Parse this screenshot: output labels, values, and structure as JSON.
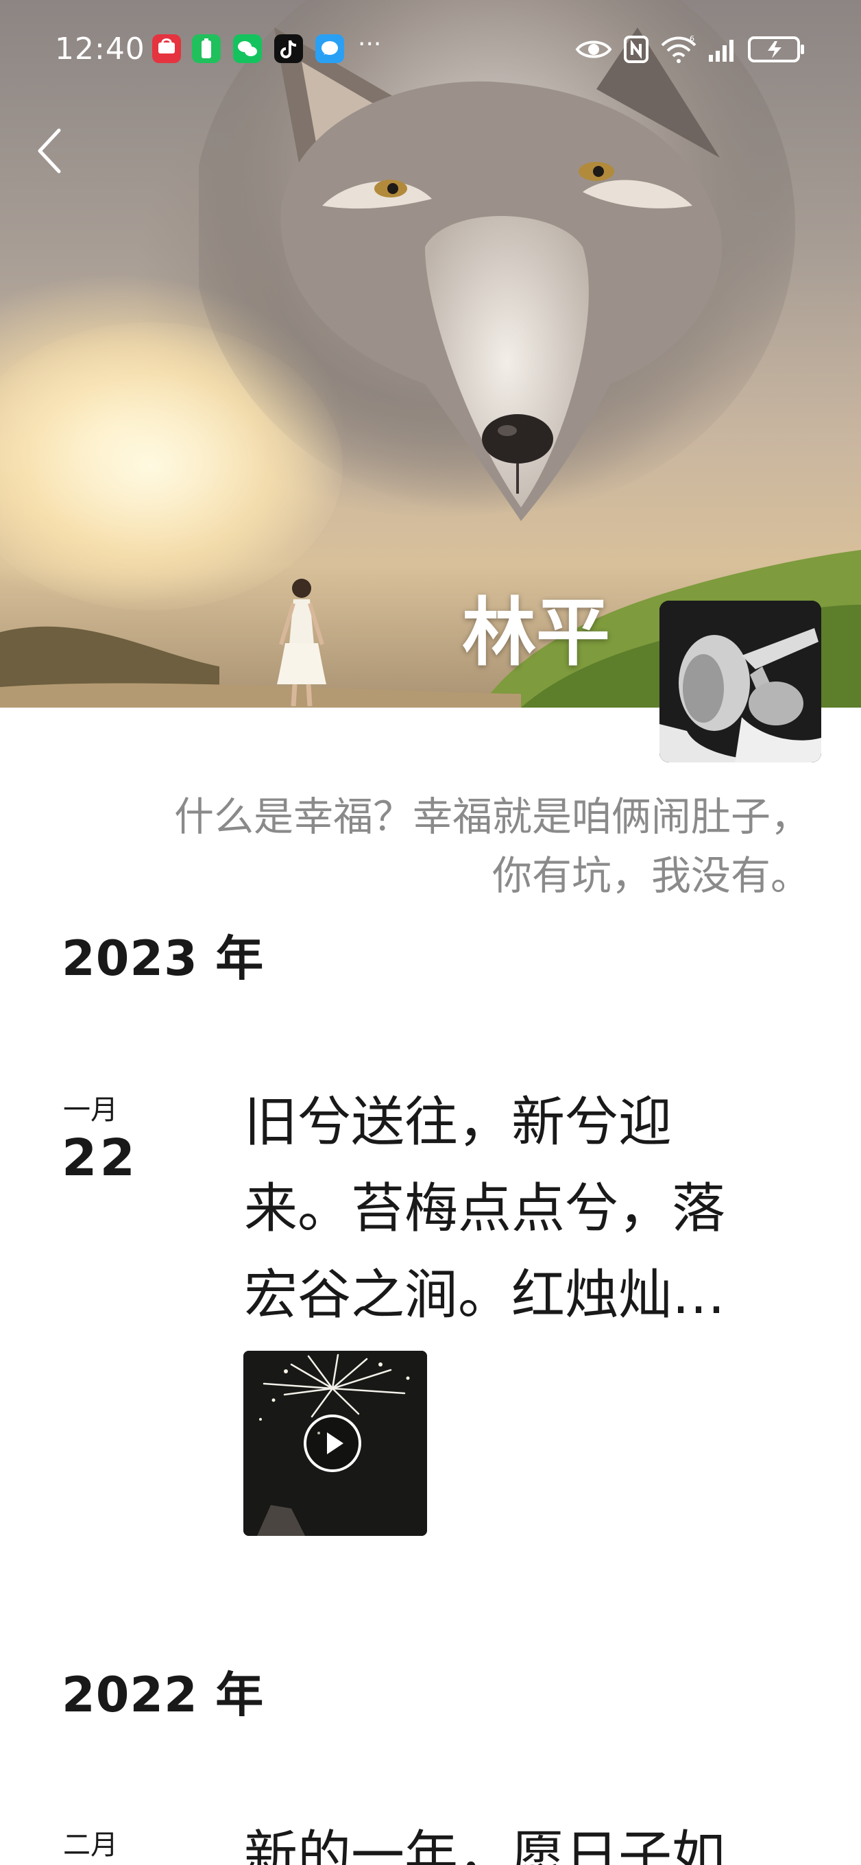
{
  "status_bar": {
    "time": "12:40",
    "app_icons": [
      "huawei-appgallery-icon",
      "battery-app-icon",
      "wechat-icon",
      "tiktok-icon",
      "message-icon"
    ],
    "overflow": "···",
    "right_icons": [
      "eye-comfort-icon",
      "nfc-icon",
      "wifi-6-icon",
      "cellular-signal-icon",
      "battery-charging-icon"
    ]
  },
  "profile": {
    "name": "林平",
    "signature_line1": "什么是幸福？幸福就是咱俩闹肚子，",
    "signature_line2": "你有坑，我没有。"
  },
  "timeline": [
    {
      "year": "2023 年",
      "posts": [
        {
          "month": "一月",
          "day": "22",
          "text_lines": [
            "旧兮送往，新兮迎",
            "来。苔梅点点兮，落",
            "宏谷之涧。红烛灿…"
          ],
          "media": "video"
        }
      ]
    },
    {
      "year": "2022 年",
      "posts": [
        {
          "month": "二月",
          "day": "",
          "text_lines": [
            "新的一年，愿日子如"
          ]
        }
      ]
    }
  ],
  "colors": {
    "text_primary": "#191919",
    "text_secondary": "#8a8a8a",
    "background": "#ffffff"
  }
}
